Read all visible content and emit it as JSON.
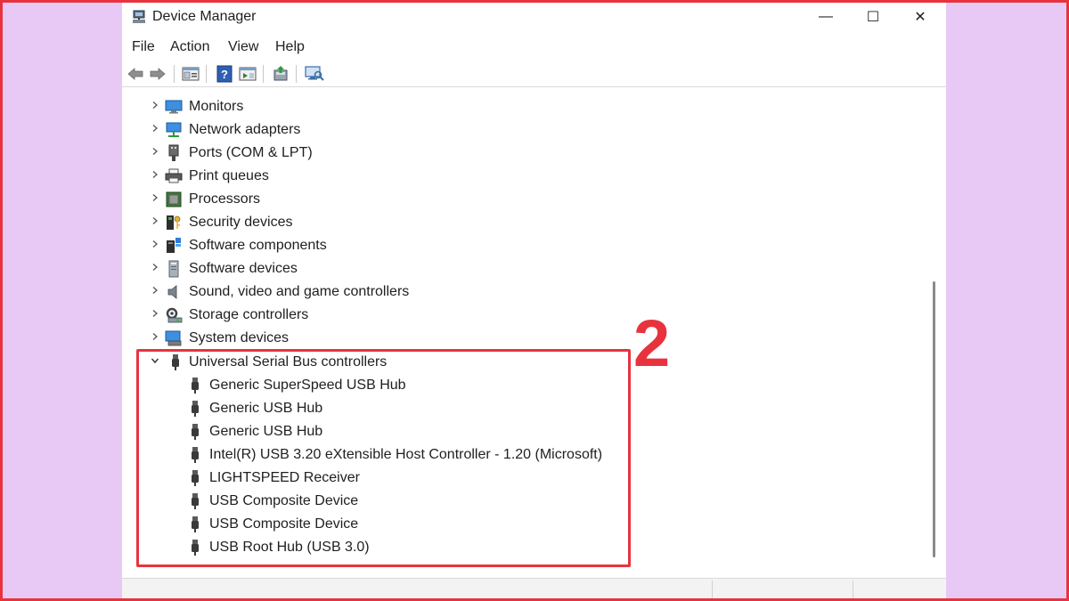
{
  "window": {
    "title": "Device Manager",
    "controls": {
      "minimize": "—",
      "maximize": "☐",
      "close": "✕"
    }
  },
  "menu": [
    "File",
    "Action",
    "View",
    "Help"
  ],
  "toolbar": {
    "buttons": [
      "back-icon",
      "forward-icon",
      "properties-icon",
      "help-icon",
      "view-icon",
      "update-driver-icon",
      "scan-hardware-icon"
    ]
  },
  "tree": {
    "categories": [
      {
        "label": "Monitors",
        "icon": "monitor-icon",
        "expanded": false
      },
      {
        "label": "Network adapters",
        "icon": "network-adapter-icon",
        "expanded": false
      },
      {
        "label": "Ports (COM & LPT)",
        "icon": "port-icon",
        "expanded": false
      },
      {
        "label": "Print queues",
        "icon": "printer-icon",
        "expanded": false
      },
      {
        "label": "Processors",
        "icon": "processor-icon",
        "expanded": false
      },
      {
        "label": "Security devices",
        "icon": "security-device-icon",
        "expanded": false
      },
      {
        "label": "Software components",
        "icon": "software-component-icon",
        "expanded": false
      },
      {
        "label": "Software devices",
        "icon": "software-device-icon",
        "expanded": false
      },
      {
        "label": "Sound, video and game controllers",
        "icon": "speaker-icon",
        "expanded": false
      },
      {
        "label": "Storage controllers",
        "icon": "storage-controller-icon",
        "expanded": false
      },
      {
        "label": "System devices",
        "icon": "system-device-icon",
        "expanded": false
      },
      {
        "label": "Universal Serial Bus controllers",
        "icon": "usb-icon",
        "expanded": true
      }
    ],
    "usb_children": [
      "Generic SuperSpeed USB Hub",
      "Generic USB Hub",
      "Generic USB Hub",
      "Intel(R) USB 3.20 eXtensible Host Controller - 1.20 (Microsoft)",
      "LIGHTSPEED Receiver",
      "USB Composite Device",
      "USB Composite Device",
      "USB Root Hub (USB 3.0)"
    ]
  },
  "annotation": {
    "step_number": "2"
  },
  "colors": {
    "accent": "#e8333e",
    "background": "#e8c9f5"
  }
}
